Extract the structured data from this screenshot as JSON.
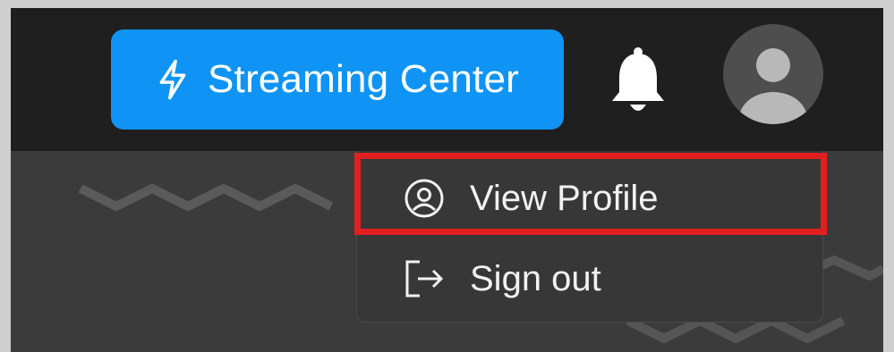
{
  "header": {
    "streaming_button": {
      "label": "Streaming Center",
      "icon": "lightning-bolt-icon",
      "color": "#0f94f5"
    },
    "notifications": {
      "icon": "bell-icon"
    },
    "account": {
      "icon": "user-avatar-icon"
    }
  },
  "profile_menu": {
    "items": [
      {
        "label": "View Profile",
        "icon": "user-circle-icon",
        "highlighted": true
      },
      {
        "label": "Sign out",
        "icon": "sign-out-icon"
      }
    ]
  },
  "colors": {
    "header_bg": "#1f1f1f",
    "content_bg": "#3b3b3b",
    "menu_bg": "#373737",
    "highlight": "#e02020"
  }
}
